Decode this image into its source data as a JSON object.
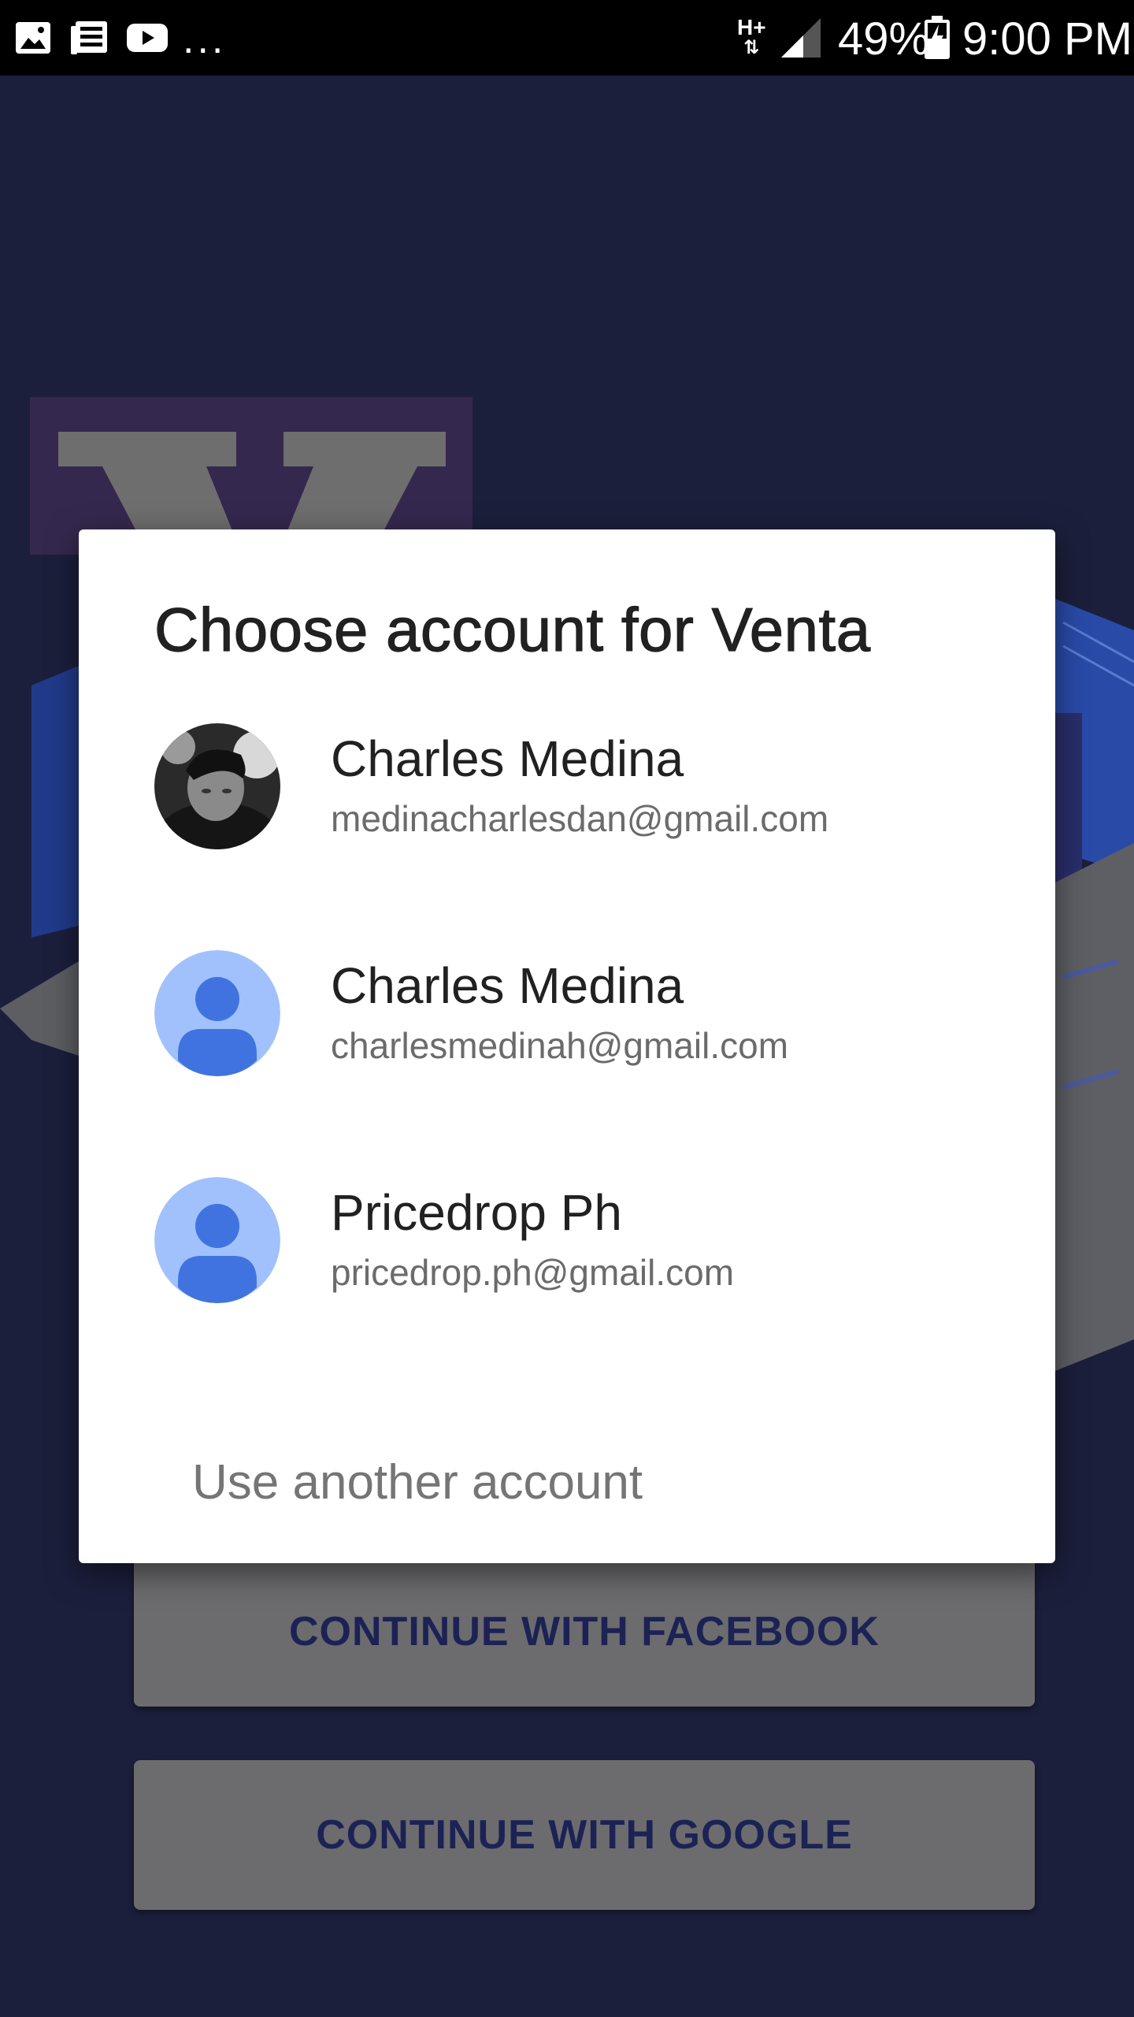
{
  "status_bar": {
    "notification_icons": [
      "image-icon",
      "news-icon",
      "youtube-icon"
    ],
    "more_notifications": "...",
    "network_type": "H+",
    "battery_percent": "49%",
    "time": "9:00 PM"
  },
  "background_app": {
    "logo_letter": "V",
    "facebook_button_label": "CONTINUE WITH FACEBOOK",
    "google_button_label": "CONTINUE WITH GOOGLE"
  },
  "dialog": {
    "title": "Choose account for Venta",
    "accounts": [
      {
        "name": "Charles Medina",
        "email": "medinacharlesdan@gmail.com",
        "avatar": "photo"
      },
      {
        "name": "Charles Medina",
        "email": "charlesmedinah@gmail.com",
        "avatar": "default-person-icon"
      },
      {
        "name": "Pricedrop Ph",
        "email": "pricedrop.ph@gmail.com",
        "avatar": "default-person-icon"
      }
    ],
    "use_another_label": "Use another account"
  },
  "colors": {
    "background": "#1c1f3c",
    "dialog": "#ffffff",
    "default_avatar_bg": "#a1c1fc",
    "default_avatar_fg": "#4173e0",
    "button_text": "#1d2255"
  }
}
